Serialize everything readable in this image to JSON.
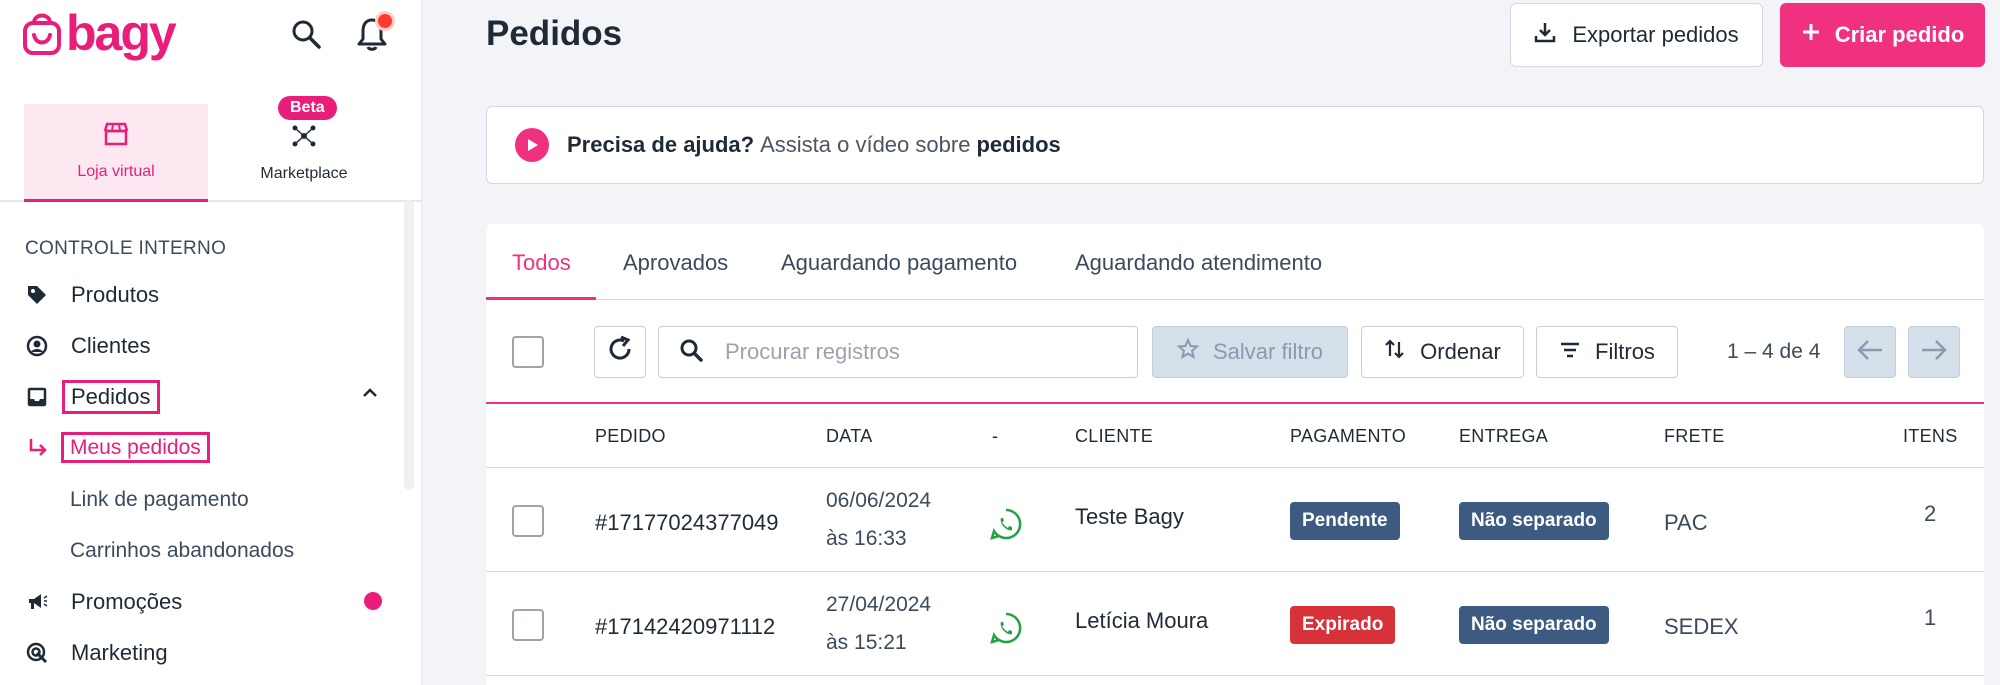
{
  "brand": {
    "name": "bagy",
    "accent": "#e91e7b"
  },
  "store_tabs": [
    {
      "label": "Loja virtual",
      "icon": "store-icon",
      "active": true
    },
    {
      "label": "Marketplace",
      "icon": "marketplace-icon",
      "active": false,
      "badge": "Beta"
    }
  ],
  "sidebar": {
    "section_title": "CONTROLE INTERNO",
    "items": [
      {
        "label": "Produtos",
        "icon": "tag-icon"
      },
      {
        "label": "Clientes",
        "icon": "user-circle-icon"
      },
      {
        "label": "Pedidos",
        "icon": "inbox-icon",
        "expanded": true
      },
      {
        "label": "Promoções",
        "icon": "megaphone-icon",
        "has_dot": true
      },
      {
        "label": "Marketing",
        "icon": "target-icon"
      }
    ],
    "sub_items": [
      {
        "label": "Meus pedidos",
        "active": true
      },
      {
        "label": "Link de pagamento"
      },
      {
        "label": "Carrinhos abandonados"
      }
    ]
  },
  "header": {
    "title": "Pedidos",
    "export_label": "Exportar pedidos",
    "create_label": "Criar pedido"
  },
  "help": {
    "lead": "Precisa de ajuda?",
    "text": "Assista o vídeo sobre",
    "bold": "pedidos"
  },
  "tabs": [
    {
      "label": "Todos",
      "active": true
    },
    {
      "label": "Aprovados"
    },
    {
      "label": "Aguardando pagamento"
    },
    {
      "label": "Aguardando atendimento"
    }
  ],
  "toolbar": {
    "search_placeholder": "Procurar registros",
    "save_filter_label": "Salvar filtro",
    "sort_label": "Ordenar",
    "filters_label": "Filtros",
    "pagination": "1 – 4 de 4"
  },
  "table": {
    "columns": [
      "PEDIDO",
      "DATA",
      "-",
      "CLIENTE",
      "PAGAMENTO",
      "ENTREGA",
      "FRETE",
      "ITENS"
    ],
    "rows": [
      {
        "order": "#17177024377049",
        "date": "06/06/2024",
        "time": "às 16:33",
        "client": "Teste Bagy",
        "payment": "Pendente",
        "payment_status": "pending",
        "delivery": "Não separado",
        "shipping": "PAC",
        "items": "2"
      },
      {
        "order": "#17142420971112",
        "date": "27/04/2024",
        "time": "às 15:21",
        "client": "Letícia Moura",
        "payment": "Expirado",
        "payment_status": "expired",
        "delivery": "Não separado",
        "shipping": "SEDEX",
        "items": "1"
      }
    ]
  }
}
